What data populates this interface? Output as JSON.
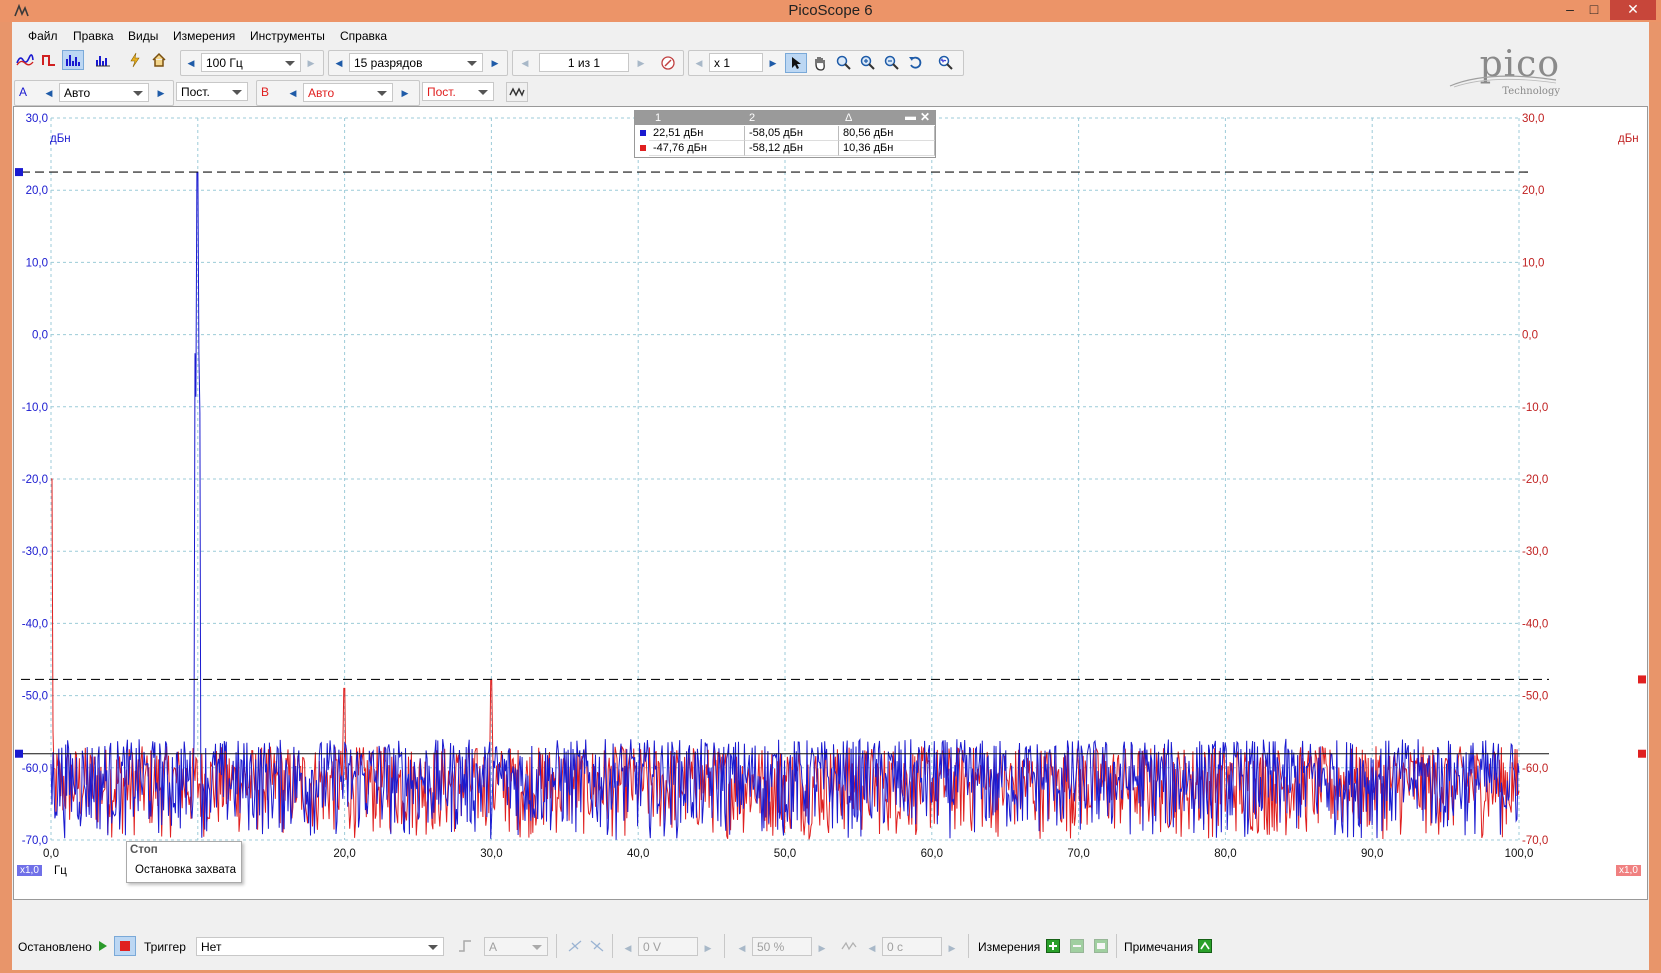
{
  "window": {
    "title": "PicoScope 6",
    "minimize": "–",
    "maximize": "□",
    "close": "✕"
  },
  "menu": [
    "Файл",
    "Правка",
    "Виды",
    "Измерения",
    "Инструменты",
    "Справка"
  ],
  "toolbar1": {
    "timebase": "100 Гц",
    "resolution": "15 разрядов",
    "buffer": "1 из 1",
    "zoom": "x 1"
  },
  "toolbar2": {
    "channel_a_label": "A",
    "channel_a_range": "Авто",
    "channel_a_coupling": "Пост.",
    "channel_b_label": "B",
    "channel_b_range": "Авто",
    "channel_b_coupling": "Пост."
  },
  "logo": {
    "brand": "pico",
    "sub": "Technology"
  },
  "axes": {
    "y_unit": "дБн",
    "y_ticks": [
      "30,0",
      "20,0",
      "10,0",
      "0,0",
      "-10,0",
      "-20,0",
      "-30,0",
      "-40,0",
      "-50,0",
      "-60,0",
      "-70,0"
    ],
    "x_ticks": [
      "0,0",
      "20,0",
      "30,0",
      "40,0",
      "50,0",
      "60,0",
      "70,0",
      "80,0",
      "90,0",
      "100,0"
    ],
    "x_unit": "Гц",
    "scale_left": "x1,0",
    "scale_right": "x1,0"
  },
  "rulers": {
    "header": [
      "1",
      "2",
      "Δ"
    ],
    "rows": [
      {
        "c1": "22,51 дБн",
        "c2": "-58,05 дБн",
        "delta": "80,56 дБн"
      },
      {
        "c1": "-47,76 дБн",
        "c2": "-58,12 дБн",
        "delta": "10,36 дБн"
      }
    ]
  },
  "tooltip": {
    "title": "Стоп",
    "text": "Остановка захвата"
  },
  "status": {
    "state": "Остановлено",
    "trigger_label": "Триггер",
    "trigger_mode": "Нет",
    "trigger_channel": "A",
    "trigger_level": "0 V",
    "trigger_pre": "50 %",
    "trigger_delay": "0 с",
    "measurements_label": "Измерения",
    "notes_label": "Примечания"
  },
  "colors": {
    "channel_a": "#1a1ad0",
    "channel_b": "#e02020",
    "window_frame": "#ec9468"
  },
  "chart_data": {
    "type": "line",
    "ylim": [
      -70,
      30
    ],
    "xlim": [
      0,
      100
    ],
    "grid": true,
    "ruler_levels": [
      22.51,
      -47.76,
      -58.05
    ],
    "peaks_a": [
      {
        "x": 10,
        "y": 22.51
      }
    ],
    "peaks_b": [
      {
        "x": 20,
        "y": -49.0
      },
      {
        "x": 30,
        "y": -47.76
      },
      {
        "x": 0,
        "y": -20.0
      }
    ],
    "noise_floor": [
      -70,
      -58
    ]
  }
}
